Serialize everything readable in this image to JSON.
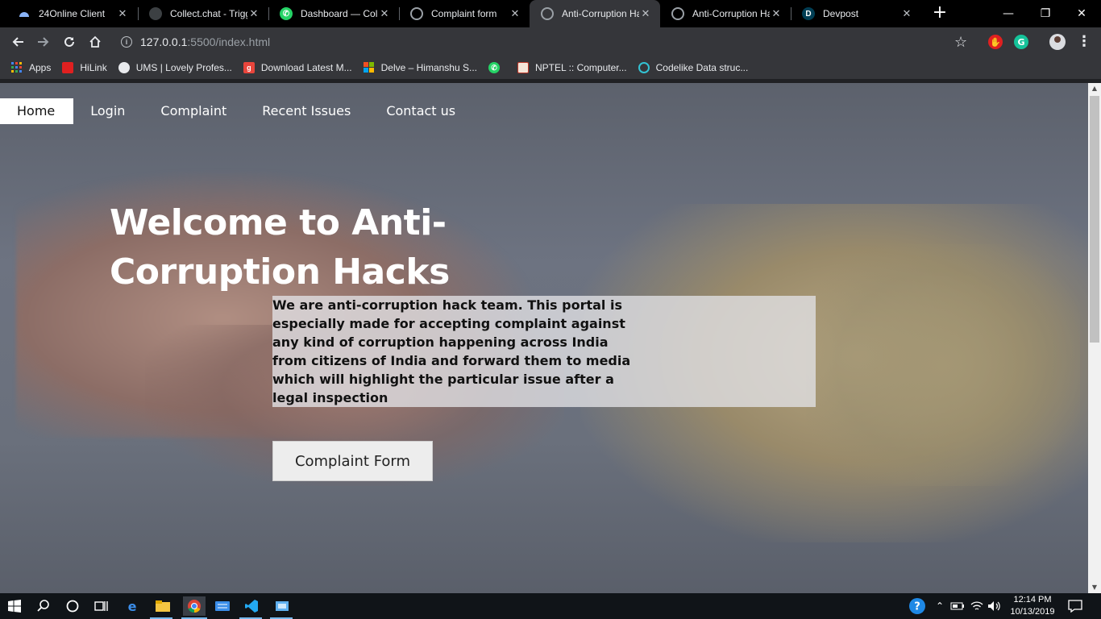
{
  "browser": {
    "tabs": [
      {
        "title": "24Online Client",
        "favicon": "cloud-icon",
        "color": "#8ab4f8",
        "active": false
      },
      {
        "title": "Collect.chat - Trigg",
        "favicon": "chat-bubble-icon",
        "color": "#3c4043",
        "active": false
      },
      {
        "title": "Dashboard — Colle",
        "favicon": "whatsapp-icon",
        "color": "#25d366",
        "active": false
      },
      {
        "title": "Complaint form",
        "favicon": "globe-icon",
        "color": "#9aa0a6",
        "active": false
      },
      {
        "title": "Anti-Corruption Ha",
        "favicon": "globe-icon",
        "color": "#9aa0a6",
        "active": true
      },
      {
        "title": "Anti-Corruption Ha",
        "favicon": "globe-icon",
        "color": "#9aa0a6",
        "active": false
      },
      {
        "title": "Devpost",
        "favicon": "devpost-icon",
        "color": "#003e54",
        "active": false
      }
    ],
    "devpost_letter": "D",
    "address": {
      "host": "127.0.0.1",
      "path": ":5500/index.html",
      "info_glyph": "i"
    },
    "bookmarks": [
      {
        "label": "Apps",
        "icon": "apps-grid-icon",
        "color": "#4285f4"
      },
      {
        "label": "HiLink",
        "icon": "huawei-icon",
        "color": "#e02020"
      },
      {
        "label": "UMS | Lovely Profes...",
        "icon": "globe-icon",
        "color": "#9aa0a6"
      },
      {
        "label": "Download Latest M...",
        "icon": "g-icon",
        "color": "#e8453c"
      },
      {
        "label": "Delve – Himanshu S...",
        "icon": "microsoft-icon",
        "color": "#f25022"
      },
      {
        "label": "",
        "icon": "whatsapp-icon",
        "color": "#25d366"
      },
      {
        "label": "NPTEL :: Computer...",
        "icon": "nptel-icon",
        "color": "#c0392b"
      },
      {
        "label": "Codelike Data struc...",
        "icon": "circle-icon",
        "color": "#33c3d4"
      }
    ],
    "bookmark_glyphs": {
      "g": "g"
    }
  },
  "site": {
    "nav": [
      "Home",
      "Login",
      "Complaint",
      "Recent Issues",
      "Contact us"
    ],
    "headline": "Welcome to Anti-Corruption Hacks",
    "intro": "We are anti-corruption hack team. This portal is especially made for accepting complaint against any kind of corruption happening across India from citizens of India and forward them to media which will highlight the particular issue after a legal inspection",
    "cta_label": "Complaint Form"
  },
  "taskbar": {
    "time": "12:14 PM",
    "date": "10/13/2019"
  }
}
